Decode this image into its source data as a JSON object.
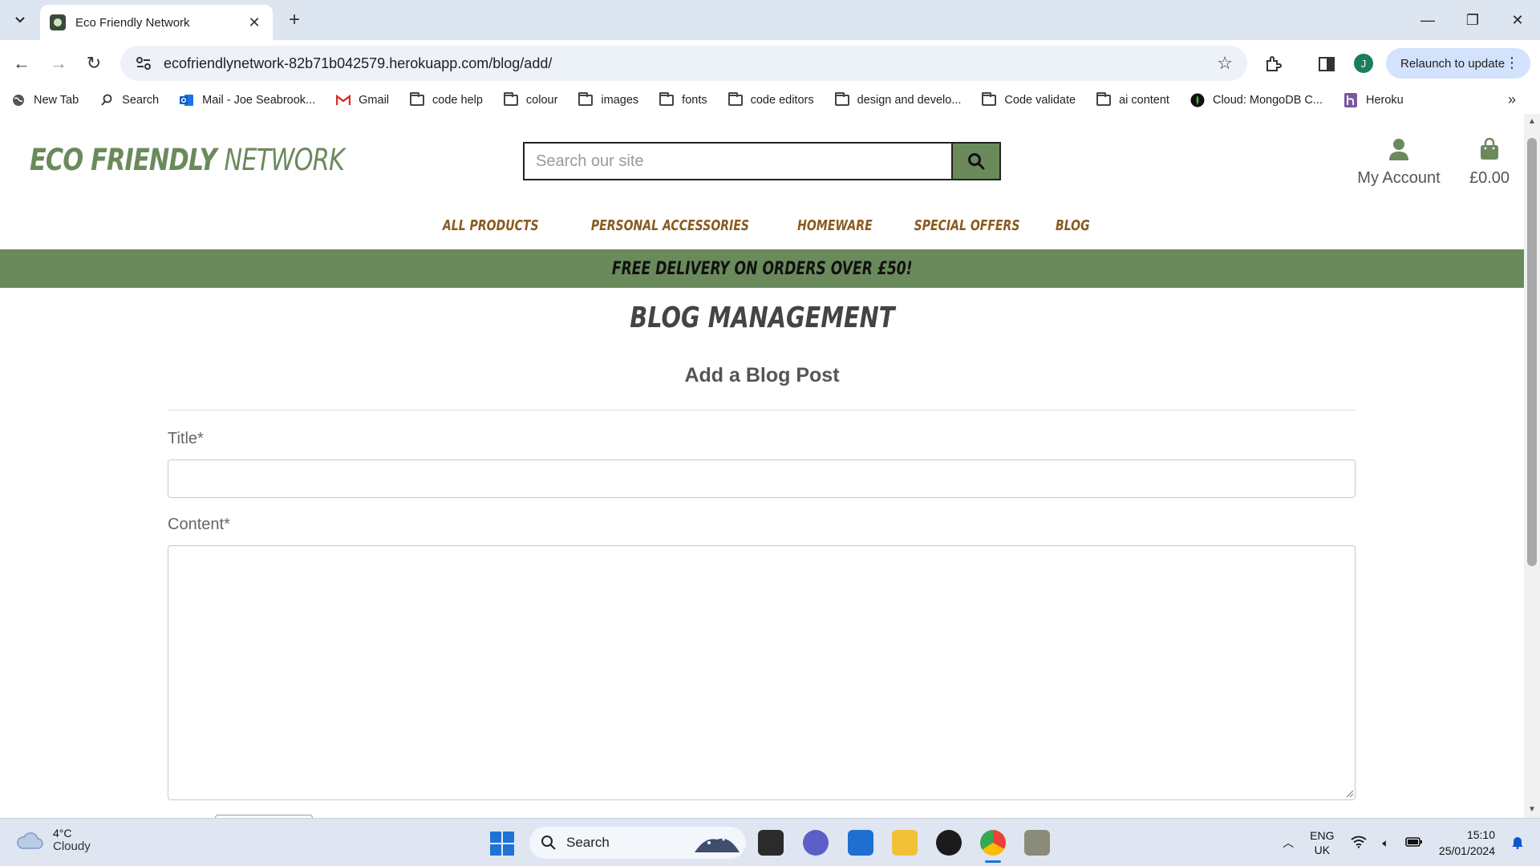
{
  "browser": {
    "tab_title": "Eco Friendly Network",
    "url": "ecofriendlynetwork-82b71b042579.herokuapp.com/blog/add/",
    "relaunch_label": "Relaunch to update",
    "profile_initial": "J",
    "bookmarks": [
      {
        "label": "New Tab",
        "icon": "globe-icon"
      },
      {
        "label": "Search",
        "icon": "search-icon"
      },
      {
        "label": "Mail - Joe Seabrook...",
        "icon": "outlook-icon"
      },
      {
        "label": "Gmail",
        "icon": "gmail-icon"
      },
      {
        "label": "code help",
        "icon": "folder-icon"
      },
      {
        "label": "colour",
        "icon": "folder-icon"
      },
      {
        "label": "images",
        "icon": "folder-icon"
      },
      {
        "label": "fonts",
        "icon": "folder-icon"
      },
      {
        "label": "code editors",
        "icon": "folder-icon"
      },
      {
        "label": "design and develo...",
        "icon": "folder-icon"
      },
      {
        "label": "Code validate",
        "icon": "folder-icon"
      },
      {
        "label": "ai content",
        "icon": "folder-icon"
      },
      {
        "label": "Cloud: MongoDB C...",
        "icon": "mongodb-icon"
      },
      {
        "label": "Heroku",
        "icon": "heroku-icon"
      }
    ]
  },
  "site": {
    "logo_part1": "ECO FRIENDLY ",
    "logo_part2": "NETWORK",
    "search_placeholder": "Search our site",
    "account_label": "My Account",
    "bag_total": "£0.00",
    "nav": [
      {
        "label": "ALL PRODUCTS"
      },
      {
        "label": "PERSONAL ACCESSORIES"
      },
      {
        "label": "HOMEWARE"
      },
      {
        "label": "SPECIAL OFFERS"
      },
      {
        "label": "BLOG"
      }
    ],
    "delivery_banner": "FREE DELIVERY ON ORDERS OVER £50!",
    "colors": {
      "brand_green": "#6b8a5c",
      "nav_brown": "#8a5a1f"
    }
  },
  "main": {
    "heading": "BLOG MANAGEMENT",
    "subheading": "Add a Blog Post",
    "title_label": "Title*",
    "title_value": "",
    "content_label": "Content*",
    "content_value": ""
  },
  "taskbar": {
    "weather_temp": "4°C",
    "weather_desc": "Cloudy",
    "search_label": "Search",
    "lang_primary": "ENG",
    "lang_region": "UK",
    "time": "15:10",
    "date": "25/01/2024"
  }
}
